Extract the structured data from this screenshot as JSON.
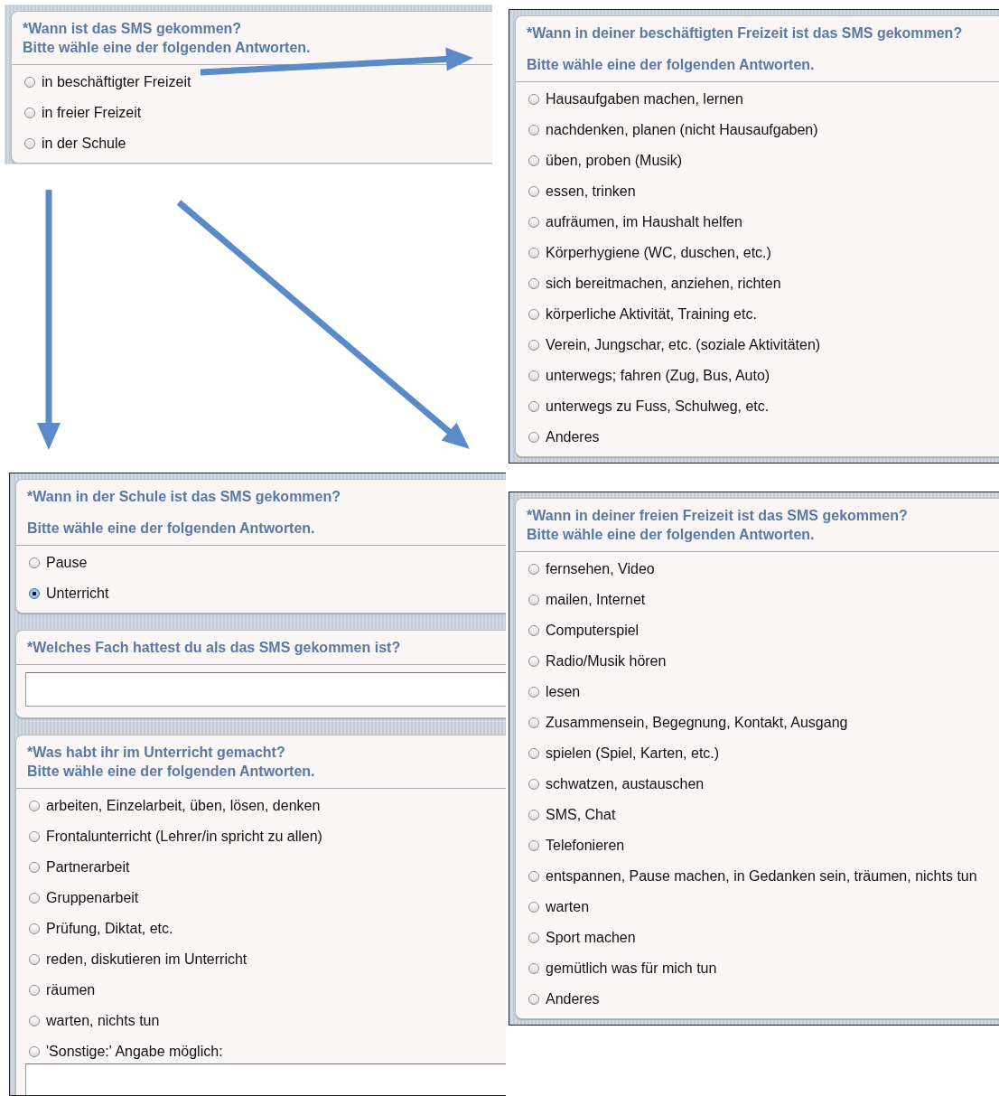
{
  "screens": [
    {
      "questions": [
        {
          "kind": "choice",
          "spaced": false,
          "title_lines": [
            "*Wann ist das SMS gekommen?",
            "Bitte wähle eine der folgenden Antworten."
          ],
          "options": [
            {
              "label": "in beschäftigter Freizeit",
              "selected": false
            },
            {
              "label": "in freier Freizeit",
              "selected": false
            },
            {
              "label": "in der Schule",
              "selected": false
            }
          ]
        }
      ]
    },
    {
      "questions": [
        {
          "kind": "choice",
          "spaced": true,
          "title_lines": [
            "*Wann in deiner beschäftigten Freizeit ist das SMS gekommen?",
            "Bitte wähle eine der folgenden Antworten."
          ],
          "options": [
            {
              "label": "Hausaufgaben machen, lernen",
              "selected": false
            },
            {
              "label": "nachdenken, planen (nicht Hausaufgaben)",
              "selected": false
            },
            {
              "label": "üben, proben (Musik)",
              "selected": false
            },
            {
              "label": "essen, trinken",
              "selected": false
            },
            {
              "label": "aufräumen, im Haushalt helfen",
              "selected": false
            },
            {
              "label": "Körperhygiene (WC, duschen, etc.)",
              "selected": false
            },
            {
              "label": "sich bereitmachen, anziehen, richten",
              "selected": false
            },
            {
              "label": "körperliche Aktivität, Training etc.",
              "selected": false
            },
            {
              "label": "Verein, Jungschar, etc. (soziale Aktivitäten)",
              "selected": false
            },
            {
              "label": "unterwegs; fahren (Zug, Bus, Auto)",
              "selected": false
            },
            {
              "label": "unterwegs zu Fuss, Schulweg, etc.",
              "selected": false
            },
            {
              "label": "Anderes",
              "selected": false
            }
          ]
        }
      ]
    },
    {
      "questions": [
        {
          "kind": "choice",
          "spaced": true,
          "title_lines": [
            "*Wann in der Schule ist das SMS gekommen?",
            "Bitte wähle eine der folgenden Antworten."
          ],
          "options": [
            {
              "label": "Pause",
              "selected": false
            },
            {
              "label": "Unterricht",
              "selected": true
            }
          ]
        },
        {
          "kind": "text",
          "title_lines": [
            "*Welches Fach hattest du als das SMS gekommen ist?"
          ]
        },
        {
          "kind": "choice",
          "spaced": false,
          "other_input": true,
          "title_lines": [
            "*Was habt ihr im Unterricht gemacht?",
            "Bitte wähle eine der folgenden Antworten."
          ],
          "options": [
            {
              "label": "arbeiten, Einzelarbeit, üben, lösen, denken",
              "selected": false
            },
            {
              "label": "Frontalunterricht (Lehrer/in spricht zu allen)",
              "selected": false
            },
            {
              "label": "Partnerarbeit",
              "selected": false
            },
            {
              "label": "Gruppenarbeit",
              "selected": false
            },
            {
              "label": "Prüfung, Diktat, etc.",
              "selected": false
            },
            {
              "label": "reden, diskutieren im Unterricht",
              "selected": false
            },
            {
              "label": "räumen",
              "selected": false
            },
            {
              "label": "warten, nichts tun",
              "selected": false
            },
            {
              "label": "'Sonstige:' Angabe möglich:",
              "selected": false
            }
          ]
        }
      ]
    },
    {
      "questions": [
        {
          "kind": "choice",
          "spaced": false,
          "title_lines": [
            "*Wann in deiner freien Freizeit ist das SMS gekommen?",
            "Bitte wähle eine der folgenden Antworten."
          ],
          "options": [
            {
              "label": "fernsehen, Video",
              "selected": false
            },
            {
              "label": "mailen, Internet",
              "selected": false
            },
            {
              "label": "Computerspiel",
              "selected": false
            },
            {
              "label": "Radio/Musik hören",
              "selected": false
            },
            {
              "label": "lesen",
              "selected": false
            },
            {
              "label": "Zusammensein, Begegnung, Kontakt, Ausgang",
              "selected": false
            },
            {
              "label": "spielen (Spiel, Karten, etc.)",
              "selected": false
            },
            {
              "label": "schwatzen, austauschen",
              "selected": false
            },
            {
              "label": "SMS, Chat",
              "selected": false
            },
            {
              "label": "Telefonieren",
              "selected": false
            },
            {
              "label": "entspannen, Pause machen, in Gedanken sein, träumen, nichts tun",
              "selected": false
            },
            {
              "label": "warten",
              "selected": false
            },
            {
              "label": "Sport machen",
              "selected": false
            },
            {
              "label": "gemütlich was für mich tun",
              "selected": false
            },
            {
              "label": "Anderes",
              "selected": false
            }
          ]
        }
      ]
    }
  ]
}
